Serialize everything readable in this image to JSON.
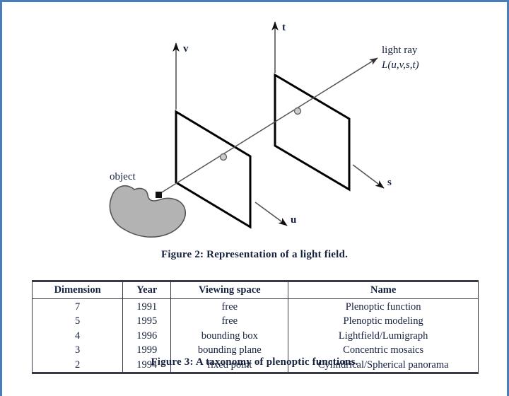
{
  "page": {
    "border_color": "#4a7ebb",
    "background": "#ffffff"
  },
  "figure2": {
    "caption": "Figure 2: Representation of a light field.",
    "axes": [
      {
        "name": "v",
        "label": "v"
      },
      {
        "name": "t",
        "label": "t"
      },
      {
        "name": "u",
        "label": "u"
      },
      {
        "name": "s",
        "label": "s"
      }
    ],
    "ray_label_line1": "light ray",
    "ray_label_line2": "L(u,v,s,t)",
    "object_label": "object",
    "plane_stroke": "#000000",
    "object_fill": "#b3b3b3",
    "object_stroke": "#555555",
    "ray_stroke": "#555555"
  },
  "figure3": {
    "caption": "Figure 3: A taxonomy of plenoptic functions.",
    "columns": [
      "Dimension",
      "Year",
      "Viewing space",
      "Name"
    ],
    "rows": [
      {
        "dimension": "7",
        "year": "1991",
        "viewing_space": "free",
        "name": "Plenoptic function"
      },
      {
        "dimension": "5",
        "year": "1995",
        "viewing_space": "free",
        "name": "Plenoptic modeling"
      },
      {
        "dimension": "4",
        "year": "1996",
        "viewing_space": "bounding box",
        "name": "Lightfield/Lumigraph"
      },
      {
        "dimension": "3",
        "year": "1999",
        "viewing_space": "bounding plane",
        "name": "Concentric mosaics"
      },
      {
        "dimension": "2",
        "year": "1994",
        "viewing_space": "fixed point",
        "name": "Cylindrical/Spherical panorama"
      }
    ]
  }
}
